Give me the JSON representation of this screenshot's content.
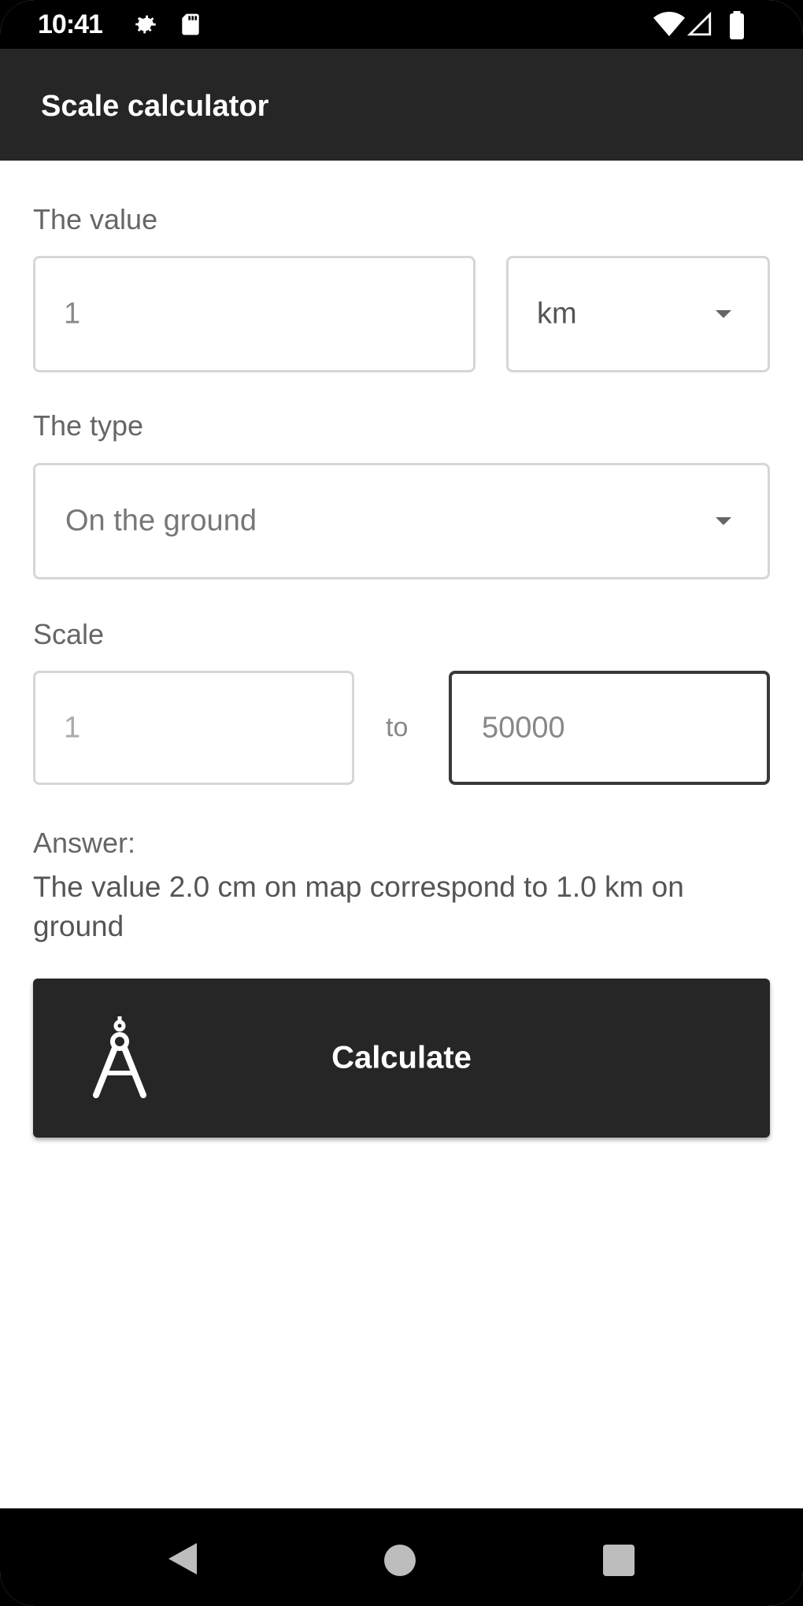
{
  "status_bar": {
    "time": "10:41",
    "left_icons": [
      "settings-icon",
      "sd-card-icon"
    ],
    "right_icons": [
      "wifi-icon",
      "signal-icon",
      "battery-icon"
    ]
  },
  "app_bar": {
    "title": "Scale calculator"
  },
  "value_section": {
    "label": "The value",
    "input_value": "1",
    "unit_selected": "km"
  },
  "type_section": {
    "label": "The type",
    "selected": "On the ground"
  },
  "scale_section": {
    "label": "Scale",
    "left_value": "1",
    "separator": "to",
    "right_value": "50000"
  },
  "answer": {
    "label": "Answer:",
    "text": "The value 2.0 cm on map correspond to 1.0 km on ground"
  },
  "calculate_button": {
    "label": "Calculate",
    "icon": "compass-drawing-icon"
  },
  "nav_bar": {
    "items": [
      "back-icon",
      "home-icon",
      "recents-icon"
    ]
  },
  "colors": {
    "app_bar": "#262626",
    "button": "#262626",
    "background": "#ffffff"
  }
}
